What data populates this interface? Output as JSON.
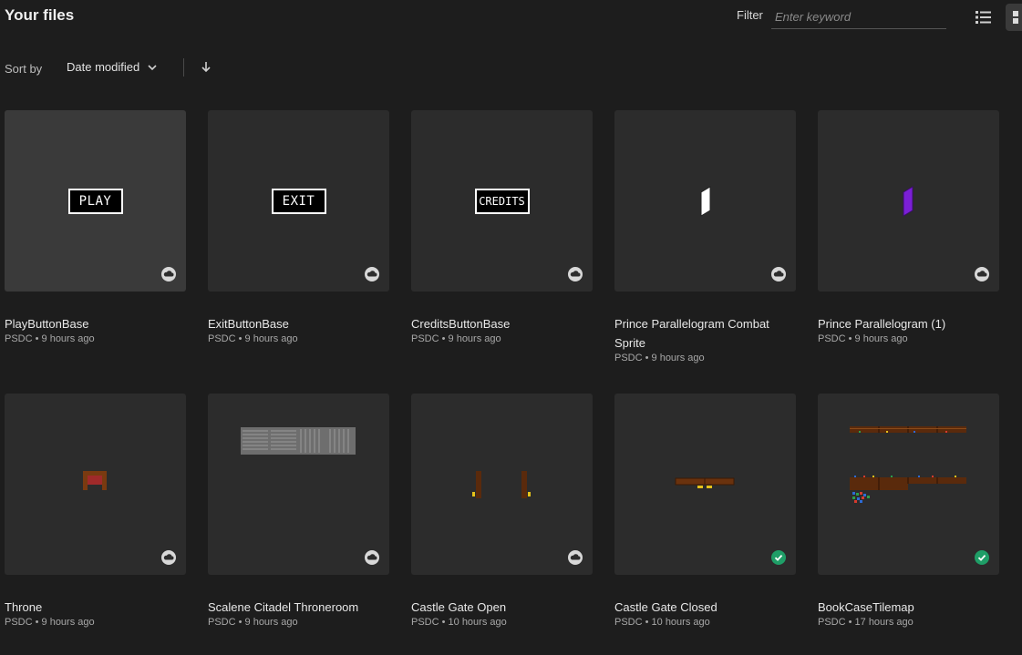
{
  "header": {
    "title": "Your files",
    "filter_label": "Filter",
    "filter_placeholder": "Enter keyword",
    "filter_value": ""
  },
  "sort": {
    "label": "Sort by",
    "selected": "Date modified",
    "direction": "descending"
  },
  "colors": {
    "background": "#1d1d1d",
    "card": "#2c2c2c",
    "synced": "#1f9e67",
    "cloud": "#d8d8d8"
  },
  "files": [
    {
      "name": "PlayButtonBase",
      "meta": "PSDC • 9 hours ago",
      "thumb_text": "PLAY",
      "status": "cloud"
    },
    {
      "name": "ExitButtonBase",
      "meta": "PSDC • 9 hours ago",
      "thumb_text": "EXIT",
      "status": "cloud"
    },
    {
      "name": "CreditsButtonBase",
      "meta": "PSDC • 9 hours ago",
      "thumb_text": "CREDITS",
      "status": "cloud"
    },
    {
      "name": "Prince Parallelogram Combat Sprite",
      "meta": "PSDC • 9 hours ago",
      "status": "cloud"
    },
    {
      "name": "Prince Parallelogram (1)",
      "meta": "PSDC • 9 hours ago",
      "status": "cloud"
    },
    {
      "name": "Throne",
      "meta": "PSDC • 9 hours ago",
      "status": "cloud"
    },
    {
      "name": "Scalene Citadel Throneroom",
      "meta": "PSDC • 9 hours ago",
      "status": "cloud"
    },
    {
      "name": "Castle Gate Open",
      "meta": "PSDC • 10 hours ago",
      "status": "cloud"
    },
    {
      "name": "Castle Gate Closed",
      "meta": "PSDC • 10 hours ago",
      "status": "synced"
    },
    {
      "name": "BookCaseTilemap",
      "meta": "PSDC • 17 hours ago",
      "status": "synced"
    }
  ]
}
